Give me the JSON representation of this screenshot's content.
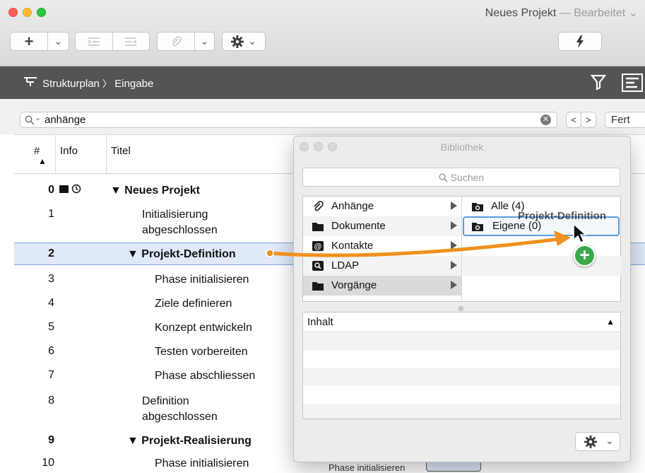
{
  "window": {
    "title": "Neues Projekt",
    "separator": "—",
    "status": "Bearbeitet",
    "colors": {
      "close": "#fc5f57",
      "minimize": "#fdbb2d",
      "zoom": "#28c840",
      "selection": "#dfe9f7",
      "accent_arrow": "#f0901e",
      "add_badge": "#3aa84a"
    }
  },
  "toolbar": {
    "add_label": "+",
    "dropdown_glyph": "⌄",
    "indent_icon": "indent-icon",
    "outdent_icon": "outdent-icon",
    "attach_icon": "paperclip-icon",
    "gear_icon": "gear-icon",
    "flash_icon": "lightning-icon"
  },
  "nav": {
    "breadcrumb_root": "Strukturplan",
    "breadcrumb_sep": "〉",
    "breadcrumb_leaf": "Eingabe",
    "filter_icon": "filter-icon",
    "layout_icon": "layout-icon"
  },
  "search": {
    "value": "anhänge",
    "prev": "<",
    "next": ">",
    "done": "Fert"
  },
  "table": {
    "headers": {
      "num": "#",
      "info": "Info",
      "title": "Titel"
    },
    "rows": [
      {
        "num": "0",
        "title": "▼ Neues Projekt",
        "level": 0,
        "bold": true
      },
      {
        "num": "1",
        "title": "Initialisierung abgeschlossen",
        "level": 1,
        "bold": false
      },
      {
        "num": "2",
        "title": "▼ Projekt-Definition",
        "level": 0,
        "bold": true,
        "selected": true
      },
      {
        "num": "3",
        "title": "Phase initialisieren",
        "level": 2,
        "bold": false
      },
      {
        "num": "4",
        "title": "Ziele definieren",
        "level": 2,
        "bold": false
      },
      {
        "num": "5",
        "title": "Konzept entwickeln",
        "level": 2,
        "bold": false
      },
      {
        "num": "6",
        "title": "Testen vorbereiten",
        "level": 2,
        "bold": false
      },
      {
        "num": "7",
        "title": "Phase abschliessen",
        "level": 2,
        "bold": false
      },
      {
        "num": "8",
        "title": "Definition abgeschlossen",
        "level": 1,
        "bold": false
      },
      {
        "num": "9",
        "title": "▼ Projekt-Realisierung",
        "level": 0,
        "bold": true
      },
      {
        "num": "10",
        "title": "Phase initialisieren",
        "level": 2,
        "bold": false
      }
    ],
    "behind_text": "Phase initialisieren"
  },
  "library": {
    "title": "Bibliothek",
    "search_placeholder": "Suchen",
    "categories": [
      {
        "label": "Anhänge",
        "icon": "paperclip-icon"
      },
      {
        "label": "Dokumente",
        "icon": "folder-icon"
      },
      {
        "label": "Kontakte",
        "icon": "at-sign-icon"
      },
      {
        "label": "LDAP",
        "icon": "ldap-search-icon"
      },
      {
        "label": "Vorgänge",
        "icon": "folder-icon"
      }
    ],
    "subitems": [
      {
        "label": "Alle (4)",
        "icon": "smart-folder-icon"
      },
      {
        "label": "Eigene (0)",
        "icon": "smart-folder-icon"
      }
    ],
    "content_header": "Inhalt",
    "drag_label": "Projekt-Definition"
  }
}
